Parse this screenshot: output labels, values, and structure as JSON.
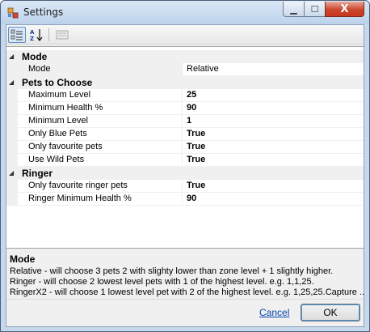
{
  "window": {
    "title": "Settings"
  },
  "titlebar_buttons": {
    "minimize": "▁",
    "maximize": "☐",
    "close": "X"
  },
  "toolbar": {
    "buttons": [
      {
        "name": "categorized",
        "icon": "categorized-icon",
        "active": true
      },
      {
        "name": "alphabetical",
        "icon": "sort-az-icon",
        "active": false
      },
      {
        "name": "property-pages",
        "icon": "property-pages-icon",
        "active": false
      }
    ]
  },
  "grid": {
    "categories": [
      {
        "label": "Mode",
        "expander": "◢",
        "properties": [
          {
            "name": "Mode",
            "value": "Relative",
            "bold": false,
            "selected": true
          }
        ]
      },
      {
        "label": "Pets to Choose",
        "expander": "◢",
        "properties": [
          {
            "name": "Maximum Level",
            "value": "25",
            "bold": true
          },
          {
            "name": "Minimum Health %",
            "value": "90",
            "bold": true
          },
          {
            "name": "Minimum Level",
            "value": "1",
            "bold": true
          },
          {
            "name": "Only Blue Pets",
            "value": "True",
            "bold": true
          },
          {
            "name": "Only favourite pets",
            "value": "True",
            "bold": true
          },
          {
            "name": "Use Wild Pets",
            "value": "True",
            "bold": true
          }
        ]
      },
      {
        "label": "Ringer",
        "expander": "◢",
        "properties": [
          {
            "name": "Only favourite ringer pets",
            "value": "True",
            "bold": true
          },
          {
            "name": "Ringer Minimum Health %",
            "value": "90",
            "bold": true
          }
        ]
      }
    ]
  },
  "description": {
    "title": "Mode",
    "lines": [
      "Relative - will choose 3 pets 2 with slighty lower than zone level + 1 slightly higher.",
      "Ringer - will choose 2 lowest level pets with 1 of the highest level. e.g. 1,1,25.",
      "RingerX2 - will choose 1 lowest level pet with 2 of the highest level. e.g. 1,25,25.Capture ..."
    ]
  },
  "footer": {
    "cancel_label": "Cancel",
    "ok_label": "OK"
  },
  "colors": {
    "title_bar": "#bcd2ea",
    "close_button": "#c8391e",
    "selection_border": "#5f8fc7",
    "link": "#0645ad"
  }
}
